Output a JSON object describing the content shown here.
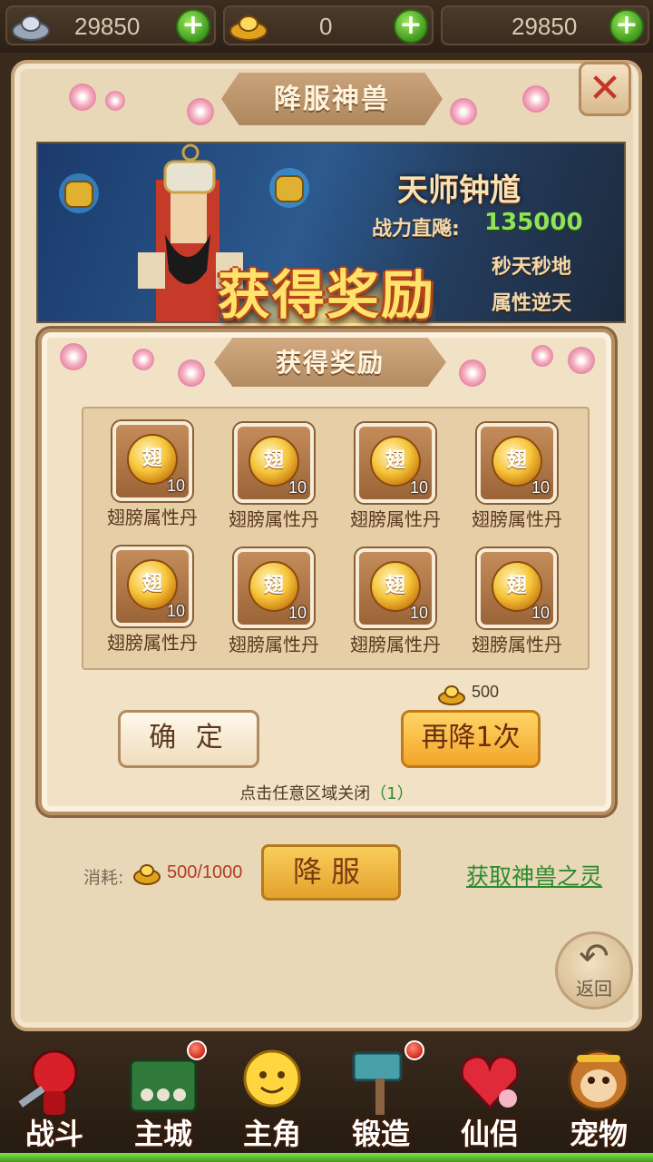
{
  "topbar": {
    "silver": "29850",
    "gold": "0",
    "other": "29850"
  },
  "window": {
    "title": "降服神兽",
    "close_icon": "close-icon"
  },
  "banner": {
    "hero_name": "天师钟馗",
    "power_label": "战力直飚:",
    "power_value": "135000",
    "tag1": "秒天秒地",
    "tag2": "属性逆天",
    "reward_text": "获得奖励"
  },
  "dialog": {
    "title": "获得奖励",
    "items": [
      {
        "icon_char": "翅",
        "qty": "10",
        "name": "翅膀属性丹"
      },
      {
        "icon_char": "翅",
        "qty": "10",
        "name": "翅膀属性丹"
      },
      {
        "icon_char": "翅",
        "qty": "10",
        "name": "翅膀属性丹"
      },
      {
        "icon_char": "翅",
        "qty": "10",
        "name": "翅膀属性丹"
      },
      {
        "icon_char": "翅",
        "qty": "10",
        "name": "翅膀属性丹"
      },
      {
        "icon_char": "翅",
        "qty": "10",
        "name": "翅膀属性丹"
      },
      {
        "icon_char": "翅",
        "qty": "10",
        "name": "翅膀属性丹"
      },
      {
        "icon_char": "翅",
        "qty": "10",
        "name": "翅膀属性丹"
      }
    ],
    "price": "500",
    "confirm_label": "确 定",
    "again_label": "再降1次",
    "close_hint": "点击任意区域关闭",
    "close_count": "（1）"
  },
  "bottom": {
    "cost_label": "消耗:",
    "cost_value": "500/1000",
    "tame_label": "降服",
    "get_link": "获取神兽之灵",
    "back_label": "返回"
  },
  "nav": [
    {
      "label": "战斗",
      "icon": "battle-icon",
      "badge": false
    },
    {
      "label": "主城",
      "icon": "city-icon",
      "badge": true
    },
    {
      "label": "主角",
      "icon": "hero-icon",
      "badge": false
    },
    {
      "label": "锻造",
      "icon": "forge-icon",
      "badge": true
    },
    {
      "label": "仙侣",
      "icon": "partner-icon",
      "badge": false
    },
    {
      "label": "宠物",
      "icon": "pet-icon",
      "badge": false
    }
  ],
  "colors": {
    "accent_gold": "#f2a52a",
    "link_green": "#2e8a2e",
    "cost_red": "#b33c26"
  }
}
